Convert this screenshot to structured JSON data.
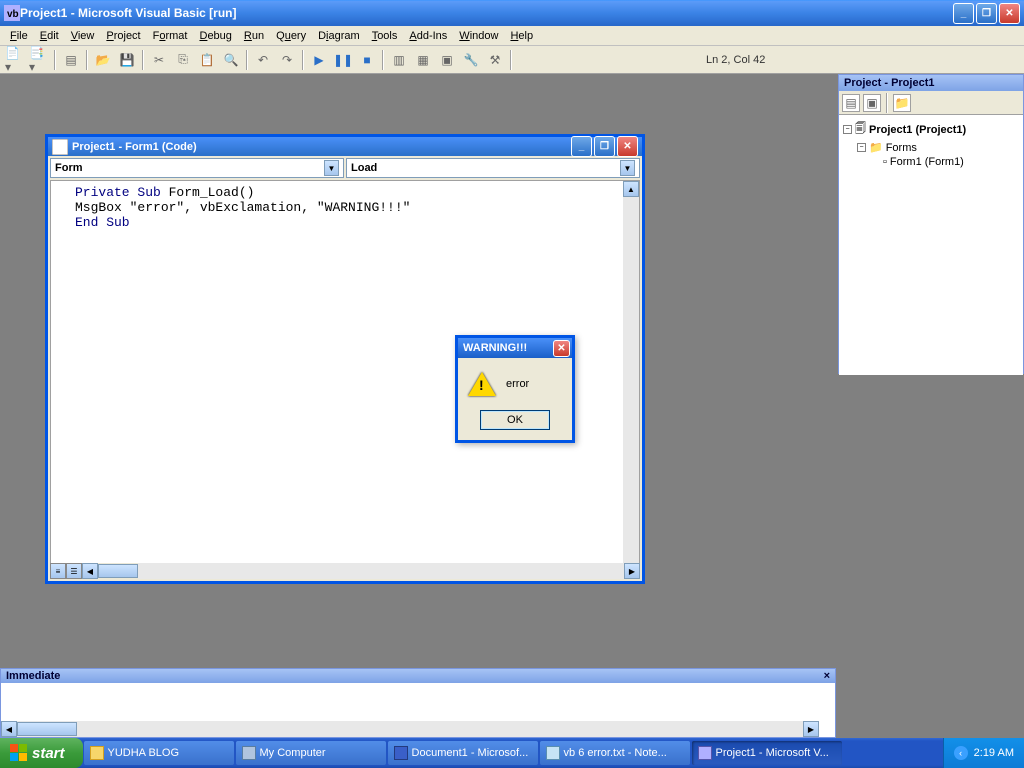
{
  "app": {
    "title": "Project1 - Microsoft Visual Basic [run]"
  },
  "menus": [
    "File",
    "Edit",
    "View",
    "Project",
    "Format",
    "Debug",
    "Run",
    "Query",
    "Diagram",
    "Tools",
    "Add-Ins",
    "Window",
    "Help"
  ],
  "status": {
    "position": "Ln 2, Col 42"
  },
  "project_panel": {
    "title": "Project - Project1",
    "root": "Project1 (Project1)",
    "folder": "Forms",
    "item": "Form1 (Form1)"
  },
  "code_window": {
    "title": "Project1 - Form1 (Code)",
    "object_dd": "Form",
    "proc_dd": "Load",
    "code_line1a": "Private Sub",
    "code_line1b": " Form_Load()",
    "code_line2": "MsgBox \"error\", vbExclamation, \"WARNING!!!\"",
    "code_line3": "End Sub"
  },
  "msgbox": {
    "title": "WARNING!!!",
    "text": "error",
    "ok": "OK"
  },
  "immediate": {
    "title": "Immediate"
  },
  "taskbar": {
    "start": "start",
    "items": [
      "YUDHA BLOG",
      "My Computer",
      "Document1 - Microsof...",
      "vb 6 error.txt - Note...",
      "Project1 - Microsoft V..."
    ],
    "clock": "2:19 AM"
  }
}
